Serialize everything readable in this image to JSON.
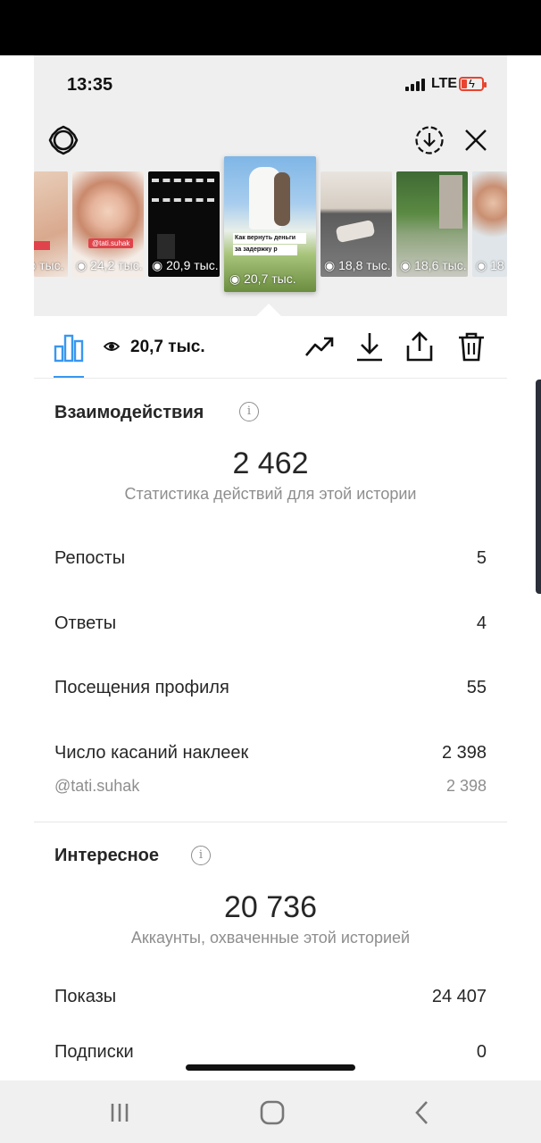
{
  "status_bar": {
    "time": "13:35",
    "network": "LTE"
  },
  "header": {
    "settings_icon": "gear-icon",
    "download_icon": "circle-download-icon",
    "close_icon": "close-icon"
  },
  "stories": [
    {
      "views": "тыс."
    },
    {
      "views": "24,2 тыс."
    },
    {
      "views": "20,9 тыс."
    },
    {
      "views": "20,7 тыс.",
      "caption_line1": "Как вернуть деньги",
      "caption_line2": "за задержку р",
      "active": true
    },
    {
      "views": "18,8 тыс."
    },
    {
      "views": "18,6 тыс."
    },
    {
      "views": "18"
    }
  ],
  "story_tag": "@tati.suhak",
  "toolbar": {
    "view_count": "20,7 тыс."
  },
  "interactions": {
    "title": "Взаимодействия",
    "total": "2 462",
    "subtitle": "Статистика действий для этой истории",
    "rows": [
      {
        "label": "Репосты",
        "value": "5"
      },
      {
        "label": "Ответы",
        "value": "4"
      },
      {
        "label": "Посещения профиля",
        "value": "55"
      },
      {
        "label": "Число касаний наклеек",
        "value": "2 398"
      }
    ],
    "sub_row": {
      "label": "@tati.suhak",
      "value": "2 398"
    }
  },
  "discovery": {
    "title": "Интересное",
    "total": "20 736",
    "subtitle": "Аккаунты, охваченные этой историей",
    "rows": [
      {
        "label": "Показы",
        "value": "24 407"
      },
      {
        "label": "Подписки",
        "value": "0"
      }
    ]
  },
  "colors": {
    "accent": "#3897f0",
    "battery": "#e8442f",
    "muted": "#8e8e8e"
  }
}
